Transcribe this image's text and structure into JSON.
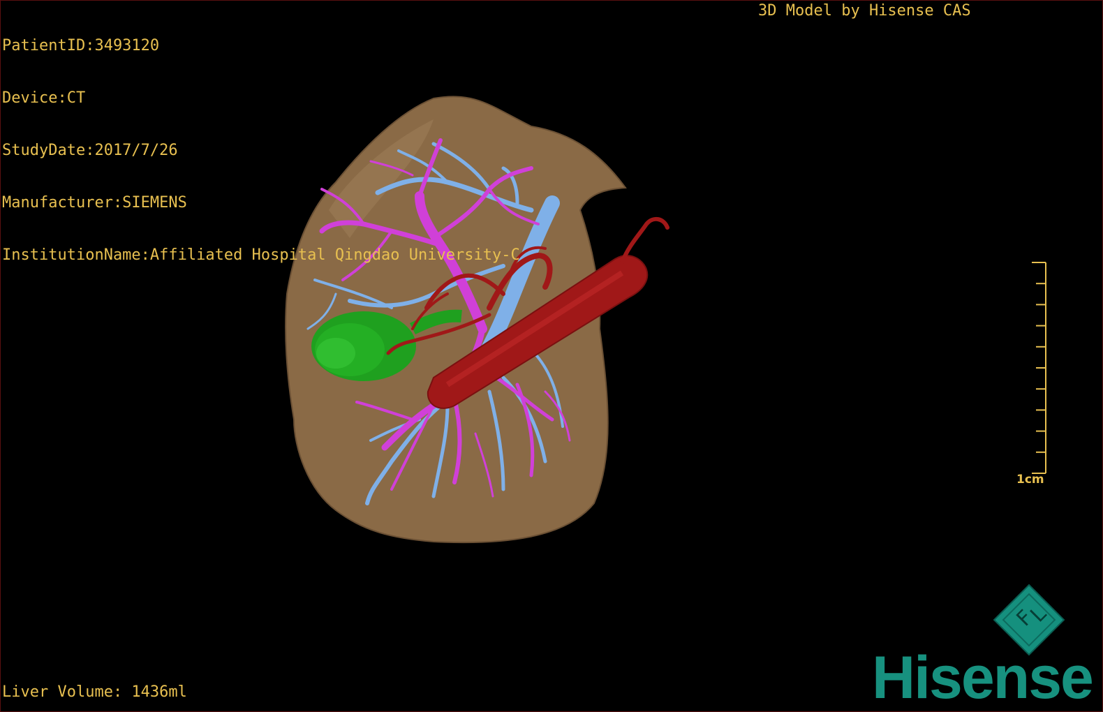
{
  "overlay": {
    "patient_id": "PatientID:3493120",
    "device": "Device:CT",
    "study_date": "StudyDate:2017/7/26",
    "manufacturer": "Manufacturer:SIEMENS",
    "institution": "InstitutionName:Affiliated Hospital Qingdao University-C",
    "brand_caption": "3D Model by Hisense CAS",
    "liver_volume": "Liver Volume: 1436ml"
  },
  "scale_bar": {
    "label": "1cm",
    "tick_count": 11
  },
  "orientation_cube": {
    "letters": [
      "F",
      "L"
    ]
  },
  "logo": {
    "wordmark": "Hisense"
  },
  "colors": {
    "overlay_text": "#e8c050",
    "liver": "#8a6a46",
    "portal_vein": "#d040d8",
    "hepatic_vein": "#7fb0e8",
    "artery_ivc": "#a01818",
    "gallbladder": "#1fa01f",
    "logo": "#17917f"
  },
  "icons": {
    "orientation_cube": "orientation-cube-icon",
    "scale_bar": "scale-ruler-icon"
  }
}
